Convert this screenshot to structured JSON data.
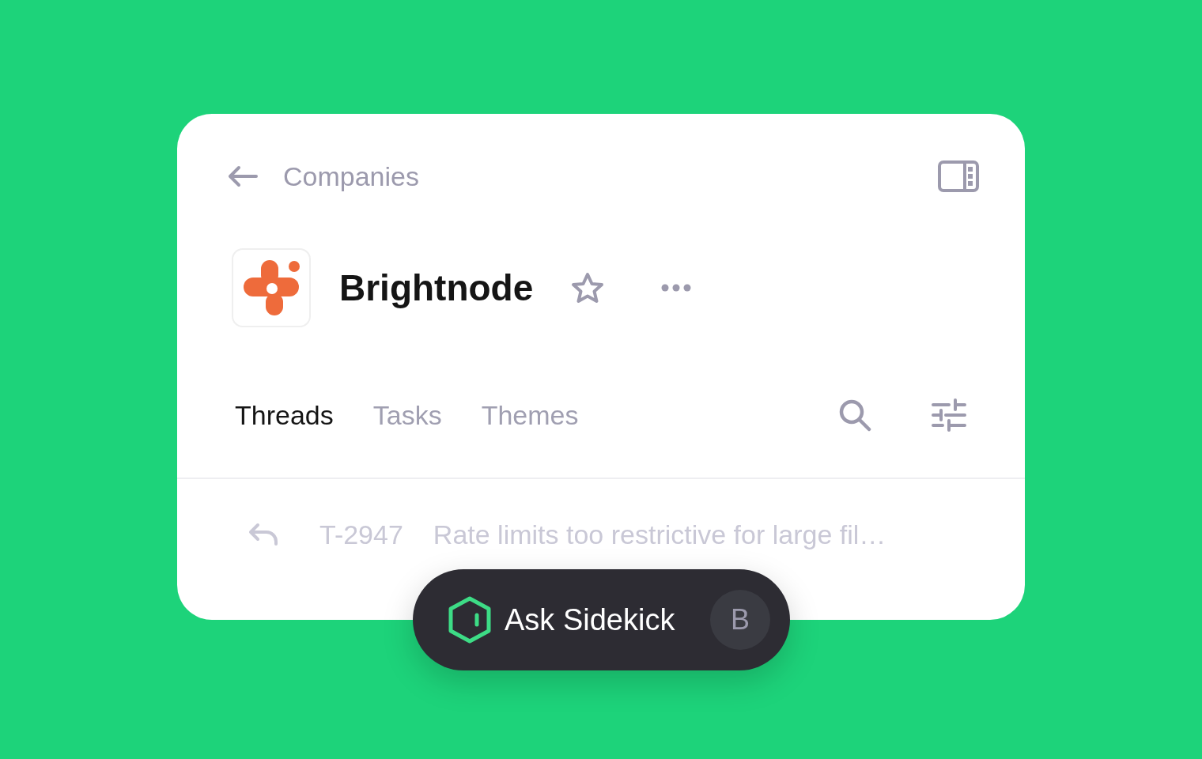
{
  "header": {
    "back_label": "Companies"
  },
  "company": {
    "name": "Brightnode",
    "starred": false
  },
  "tabs": [
    {
      "label": "Threads",
      "selected": true
    },
    {
      "label": "Tasks",
      "selected": false
    },
    {
      "label": "Themes",
      "selected": false
    }
  ],
  "threads": [
    {
      "id": "T-2947",
      "title": "Rate limits too restrictive for large fil…"
    }
  ],
  "sidekick": {
    "label": "Ask Sidekick",
    "shortcut": "B"
  }
}
